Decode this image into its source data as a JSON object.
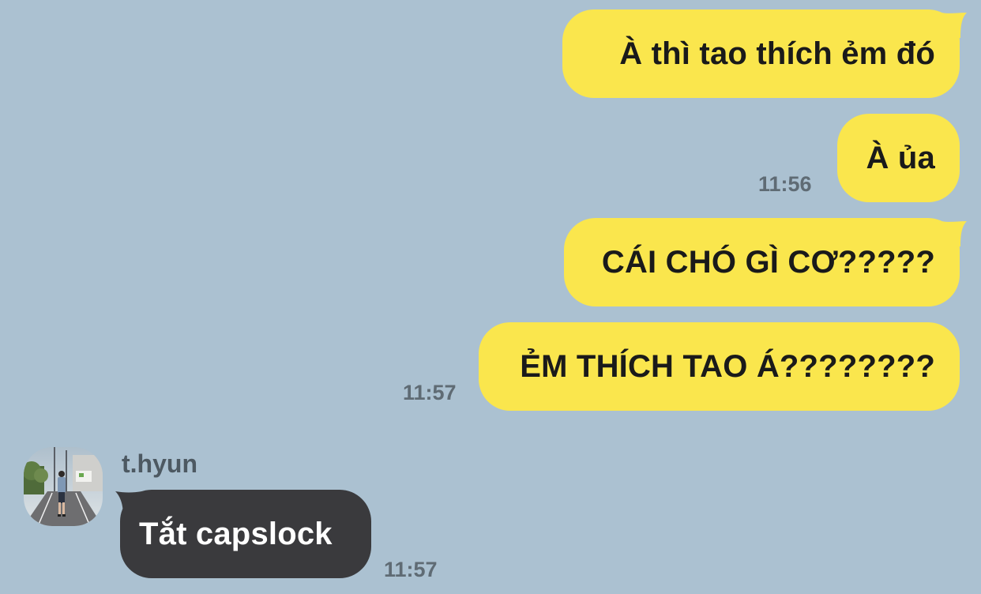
{
  "chat": {
    "background_color": "#abc1d1",
    "outgoing_color": "#fae64d",
    "incoming_color": "#3a3a3d",
    "messages": [
      {
        "text": "À thì tao thích ẻm đó"
      },
      {
        "text": "À ủa",
        "time": "11:56"
      },
      {
        "text": "CÁI CHÓ GÌ CƠ?????"
      },
      {
        "text": "ẺM THÍCH TAO Á????????",
        "time": "11:57"
      },
      {
        "sender": "t.hyun",
        "avatar_icon": "profile-photo-avatar",
        "text": "Tắt capslock",
        "time": "11:57"
      }
    ]
  }
}
